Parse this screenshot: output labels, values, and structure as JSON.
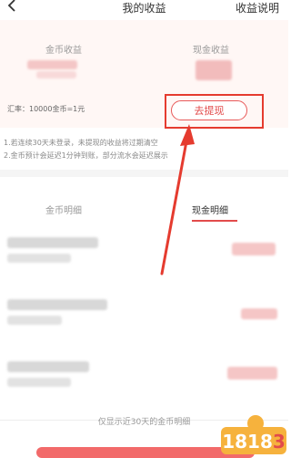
{
  "header": {
    "title": "我的收益",
    "help_link": "收益说明"
  },
  "earnings": {
    "coin_label": "金币收益",
    "cash_label": "现金收益",
    "rate_text": "汇率：10000金币=1元",
    "withdraw_label": "去提现"
  },
  "notes": [
    "1.若连续30天未登录，未提现的收益将过期清空",
    "2.金币预计会延迟1分钟到账，部分流水会延迟展示"
  ],
  "tabs": {
    "coin": "金币明细",
    "cash": "现金明细"
  },
  "footer": {
    "text": "仅显示近30天的金币明细"
  },
  "watermark": {
    "text": "1818",
    "num": "3"
  },
  "colors": {
    "accent": "#e24b4b",
    "annotation": "#e53b2f",
    "brand_orange": "#f6b23d"
  }
}
